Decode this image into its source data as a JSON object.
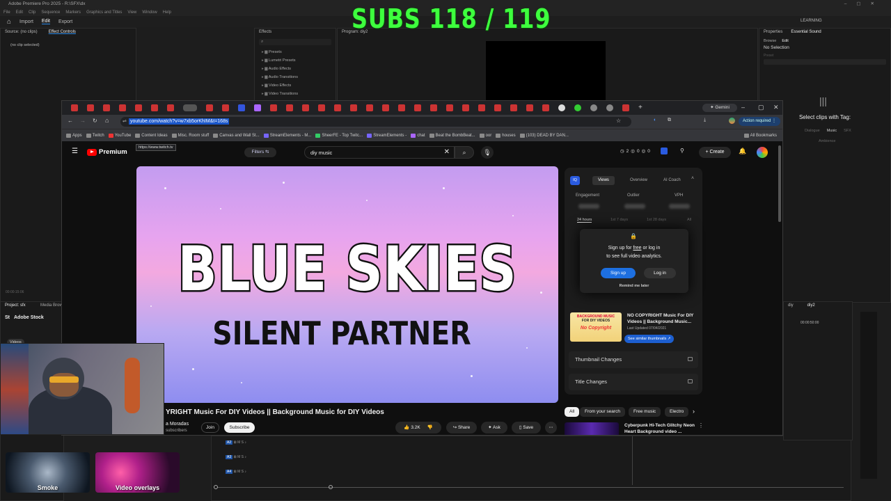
{
  "premiere": {
    "title": "Adobe Premiere Pro 2025 - R:\\SFX\\dx",
    "menus": [
      "File",
      "Edit",
      "Clip",
      "Sequence",
      "Markers",
      "Graphics and Titles",
      "View",
      "Window",
      "Help"
    ],
    "workspace_tabs": [
      "Import",
      "Edit",
      "Export"
    ],
    "learning_label": "LEARNING",
    "source_panel": {
      "tab1": "Source: (no clips)",
      "tab2": "Effect Controls",
      "no_clip": "(no clip selected)",
      "timecode": "00:00:15:06"
    },
    "effects_panel": {
      "title": "Effects",
      "items": [
        "Presets",
        "Lumetri Presets",
        "Audio Effects",
        "Audio Transitions",
        "Video Effects",
        "Video Transitions"
      ]
    },
    "program_panel": {
      "title": "Program: diy2"
    },
    "essential_sound": {
      "tab1": "Properties",
      "tab2": "Essential Sound",
      "browse": "Browse",
      "edit": "Edit",
      "no_selection": "No Selection",
      "preset_label": "Preset",
      "select_clips": "Select clips with Tag:",
      "tags": [
        "Dialogue",
        "Music",
        "SFX",
        "Ambience"
      ]
    },
    "project_panel": {
      "tab1": "Project: sfx",
      "tab2": "Media Brows...",
      "stock": "Adobe Stock",
      "videos": "Videos"
    },
    "timeline": {
      "tabs": [
        "diy",
        "diy2"
      ],
      "timecode": "00:00:50:00",
      "tracks": [
        "A2",
        "A3",
        "A4"
      ]
    },
    "thumbs": [
      "Smoke",
      "Video overlays"
    ]
  },
  "overlay": {
    "subs": "SUBS 118 / 119"
  },
  "chrome": {
    "gemini": "Gemini",
    "url": "youtube.com/watch?v=w7xb5orKhIM&t=168s",
    "action_required": "Action required",
    "bookmarks": [
      "Apps",
      "Twitch",
      "YouTube",
      "Content Ideas",
      "Misc. Room stuff",
      "Canvas and Wall St...",
      "StreamElements - M...",
      "SheerFE - Top Twitc...",
      "StreamElements -",
      "chat",
      "Beat the BombBeat...",
      "oor",
      "houses",
      "(103) DEAD BY DAN..."
    ],
    "all_bookmarks": "All Bookmarks",
    "tooltip": "https://www.twitch.tv"
  },
  "youtube": {
    "logo": "Premium",
    "filters": "Filters",
    "search_value": "diy music",
    "header_counts": [
      "2",
      "0",
      "0"
    ],
    "create": "Create",
    "video_text1": "BLUE SKIES",
    "video_text2": "SILENT PARTNER",
    "title": "YRIGHT Music For DIY Videos || Background Music for DIY Videos",
    "channel": "a Moradas",
    "subscribers": "subscribers",
    "join": "Join",
    "subscribe": "Subscribe",
    "likes": "3.2K",
    "share": "Share",
    "ask": "Ask",
    "save": "Save",
    "analytics": {
      "badge": "IQ",
      "tabs": [
        "Views",
        "Overview",
        "AI Coach"
      ],
      "metrics": [
        "Engagement",
        "Outlier",
        "VPH"
      ],
      "ranges": [
        "24 hours",
        "1st 7 days",
        "1st 28 days",
        "All"
      ],
      "popup_line1": "Sign up for ",
      "popup_free": "free",
      "popup_line1b": " or log in",
      "popup_line2": "to see full video analytics.",
      "signup": "Sign up",
      "login": "Log in",
      "remind": "Remind me later",
      "card_title": "NO COPYRIGHT Music For DIY Videos || Background Music...",
      "card_updated": "Last Updated 07/04/2021",
      "card_thumb_text": [
        "BACKGROUND MUSIC",
        "FOR DIY VIDEOS",
        "No Copyright"
      ],
      "see_similar": "See similar thumbnails ↗",
      "thumbnail_changes": "Thumbnail Changes",
      "title_changes": "Title Changes"
    },
    "chips": [
      "All",
      "From your search",
      "Free music",
      "Electro"
    ],
    "rec_title": "Cyberpunk Hi-Tech Glitchy Neon Heart Background video ..."
  }
}
